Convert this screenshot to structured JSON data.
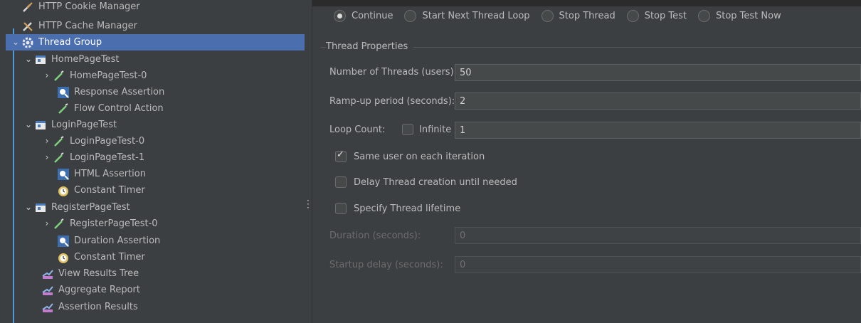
{
  "tree": {
    "items": [
      {
        "label": "HTTP Cookie Manager",
        "icon": "wrench-icon"
      },
      {
        "label": "HTTP Cache Manager",
        "icon": "wrench-icon"
      },
      {
        "label": "Thread Group",
        "icon": "gear-icon"
      },
      {
        "label": "HomePageTest",
        "icon": "controller-icon"
      },
      {
        "label": "HomePageTest-0",
        "icon": "pipette-icon"
      },
      {
        "label": "Response Assertion",
        "icon": "magnifier-icon"
      },
      {
        "label": "Flow Control Action",
        "icon": "pipette-icon"
      },
      {
        "label": "LoginPageTest",
        "icon": "controller-icon"
      },
      {
        "label": "LoginPageTest-0",
        "icon": "pipette-icon"
      },
      {
        "label": "LoginPageTest-1",
        "icon": "pipette-icon"
      },
      {
        "label": "HTML Assertion",
        "icon": "magnifier-icon"
      },
      {
        "label": "Constant Timer",
        "icon": "timer-icon"
      },
      {
        "label": "RegisterPageTest",
        "icon": "controller-icon"
      },
      {
        "label": "RegisterPageTest-0",
        "icon": "pipette-icon"
      },
      {
        "label": "Duration Assertion",
        "icon": "magnifier-icon"
      },
      {
        "label": "Constant Timer",
        "icon": "timer-icon"
      },
      {
        "label": "View Results Tree",
        "icon": "graph-icon"
      },
      {
        "label": "Aggregate Report",
        "icon": "graph-icon"
      },
      {
        "label": "Assertion Results",
        "icon": "graph-icon"
      }
    ]
  },
  "sampler_error_action": {
    "options": [
      "Continue",
      "Start Next Thread Loop",
      "Stop Thread",
      "Stop Test",
      "Stop Test Now"
    ],
    "selected": "Continue"
  },
  "thread_properties": {
    "legend": "Thread Properties",
    "num_threads_label": "Number of Threads (users):",
    "num_threads_value": "50",
    "ramp_up_label": "Ramp-up period (seconds):",
    "ramp_up_value": "2",
    "loop_count_label": "Loop Count:",
    "infinite_label": "Infinite",
    "loop_count_value": "1",
    "same_user_label": "Same user on each iteration",
    "same_user_checked": true,
    "delay_creation_label": "Delay Thread creation until needed",
    "specify_lifetime_label": "Specify Thread lifetime",
    "duration_label": "Duration (seconds):",
    "duration_value": "0",
    "startup_delay_label": "Startup delay (seconds):",
    "startup_delay_value": "0"
  }
}
